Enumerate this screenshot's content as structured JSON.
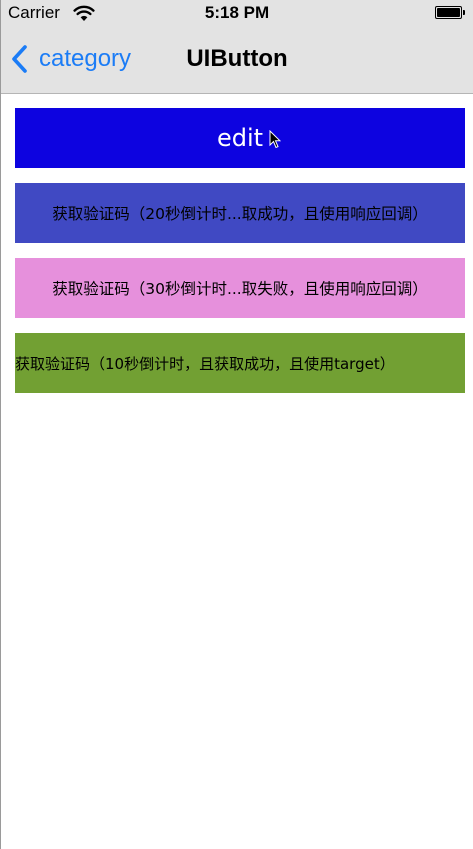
{
  "status_bar": {
    "carrier": "Carrier",
    "time": "5:18 PM"
  },
  "nav": {
    "back_label": "category",
    "title": "UIButton",
    "accent_color": "#1b7cf6"
  },
  "buttons": [
    {
      "label": "edit",
      "color": "#0d03e0"
    },
    {
      "label": "获取验证码（20秒倒计时...取成功，且使用响应回调）",
      "color": "#4049c3"
    },
    {
      "label": "获取验证码（30秒倒计时...取失败，且使用响应回调）",
      "color": "#e690dc"
    },
    {
      "label": "获取验证码（10秒倒计时，且获取成功，且使用target）",
      "color": "#72a033"
    }
  ],
  "icons": {
    "wifi": "wifi-icon",
    "battery": "battery-icon",
    "back": "chevron-left-icon",
    "cursor": "mouse-pointer-icon"
  }
}
